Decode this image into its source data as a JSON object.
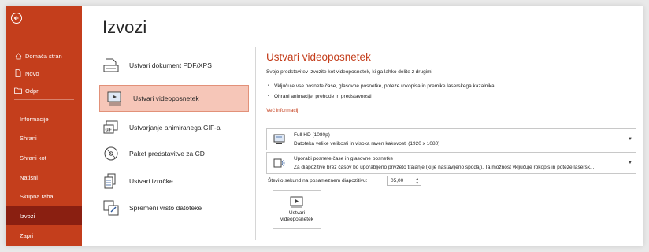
{
  "sidebar": {
    "items": [
      {
        "label": "Domača stran",
        "icon": "home-icon"
      },
      {
        "label": "Novo",
        "icon": "new-file-icon"
      },
      {
        "label": "Odpri",
        "icon": "folder-icon"
      },
      {
        "label": "Informacije"
      },
      {
        "label": "Shrani"
      },
      {
        "label": "Shrani kot"
      },
      {
        "label": "Natisni"
      },
      {
        "label": "Skupna raba"
      },
      {
        "label": "Izvozi"
      },
      {
        "label": "Zapri"
      }
    ],
    "active": "Izvozi",
    "color": "#c43e1c",
    "active_color": "#8a1f11"
  },
  "main": {
    "title": "Izvozi",
    "options": [
      {
        "label": "Ustvari dokument PDF/XPS",
        "icon": "pdf-document-icon"
      },
      {
        "label": "Ustvari videoposnetek",
        "icon": "video-icon"
      },
      {
        "label": "Ustvarjanje animiranega GIF-a",
        "icon": "gif-icon"
      },
      {
        "label": "Paket predstavitve za CD",
        "icon": "cd-package-icon"
      },
      {
        "label": "Ustvari izročke",
        "icon": "handouts-icon"
      },
      {
        "label": "Spremeni vrsto datoteke",
        "icon": "change-file-type-icon"
      }
    ],
    "selected_option": "Ustvari videoposnetek"
  },
  "panel": {
    "title": "Ustvari videoposnetek",
    "description": "Svojo predstavitev izvozite kot videoposnetek, ki ga lahko delite z drugimi",
    "bullets": [
      "Vključuje vse posnete čase, glasovne posnetke, poteze rokopisa in premike laserskega kazalnika",
      "Ohrani animacije, prehode in predstavnosti"
    ],
    "more_info": "Več informacij",
    "quality": {
      "title": "Full HD (1080p)",
      "subtitle": "Datoteka velike velikosti in visoka raven kakovosti (1920 x 1080)"
    },
    "timings": {
      "title": "Uporabi posnete čase in glasovne posnetke",
      "subtitle": "Za diapozitive brez časov bo uporabljeno privzeto trajanje (ki je nastavljeno spodaj). Ta možnost vključuje rokopis in poteze lasersk..."
    },
    "seconds_label": "Število sekund na posameznem diapozitivu:",
    "seconds_value": "05,00",
    "create_button": "Ustvari videoposnetek",
    "accent": "#c43e1c"
  }
}
